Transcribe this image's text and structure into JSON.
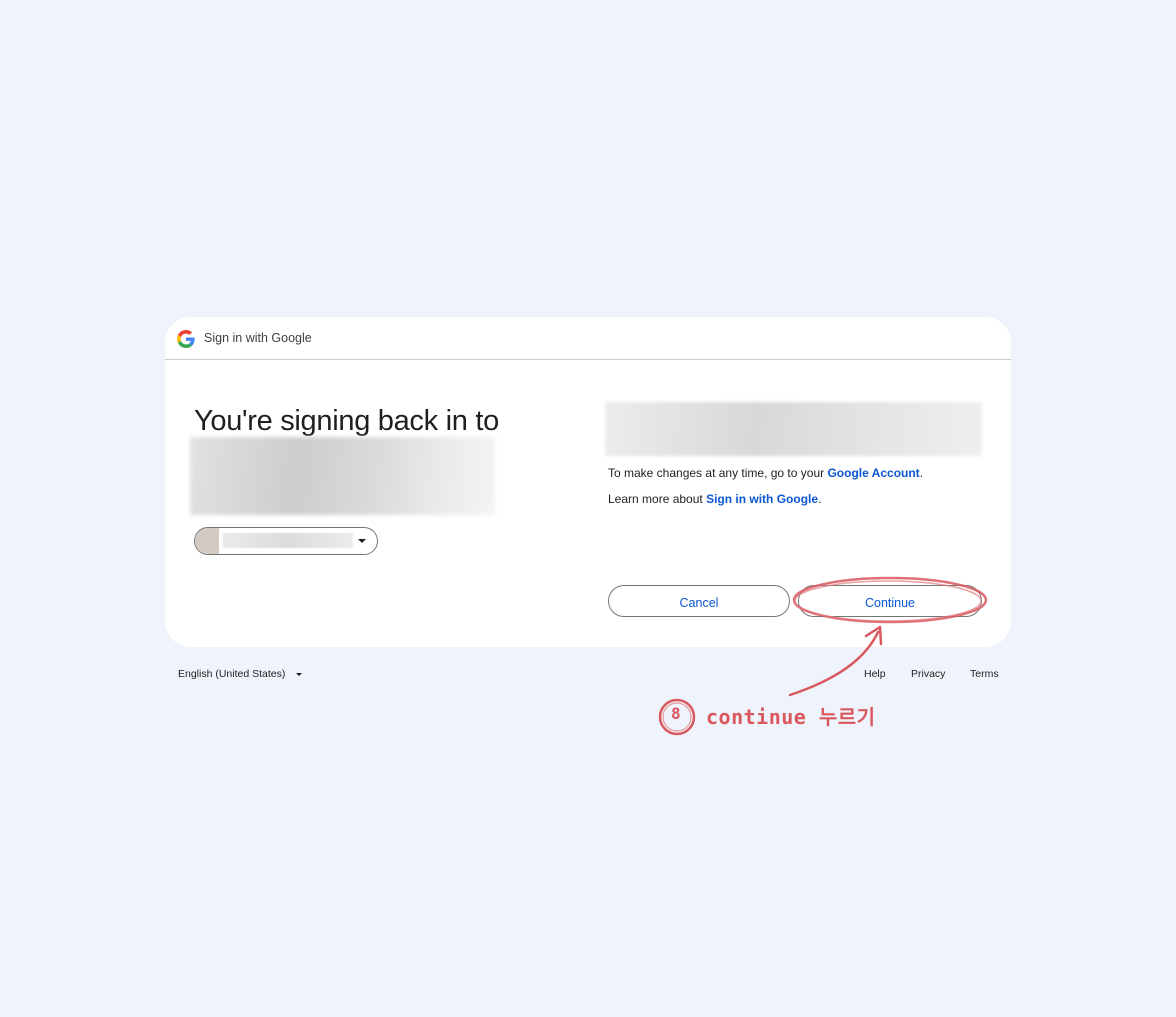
{
  "dialog": {
    "header_title": "Sign in with Google",
    "heading": "You're signing back in to",
    "info_line_1_prefix": "To make changes at any time, go to your ",
    "info_line_1_link": "Google Account",
    "info_line_1_suffix": ".",
    "info_line_2_prefix": "Learn more about ",
    "info_line_2_link": "Sign in with Google",
    "info_line_2_suffix": ".",
    "cancel_label": "Cancel",
    "continue_label": "Continue"
  },
  "footer": {
    "language": "English (United States)",
    "links": [
      "Help",
      "Privacy",
      "Terms"
    ]
  },
  "annotation": {
    "step_number": "8",
    "text": "continue 누르기",
    "color": "#d9585e"
  },
  "colors": {
    "background": "#eff3fb",
    "link": "#0b57d0",
    "card": "#ffffff"
  },
  "icons": {
    "header_logo": "google-g-icon",
    "account_dropdown": "caret-down-icon",
    "language_dropdown": "caret-down-icon"
  }
}
